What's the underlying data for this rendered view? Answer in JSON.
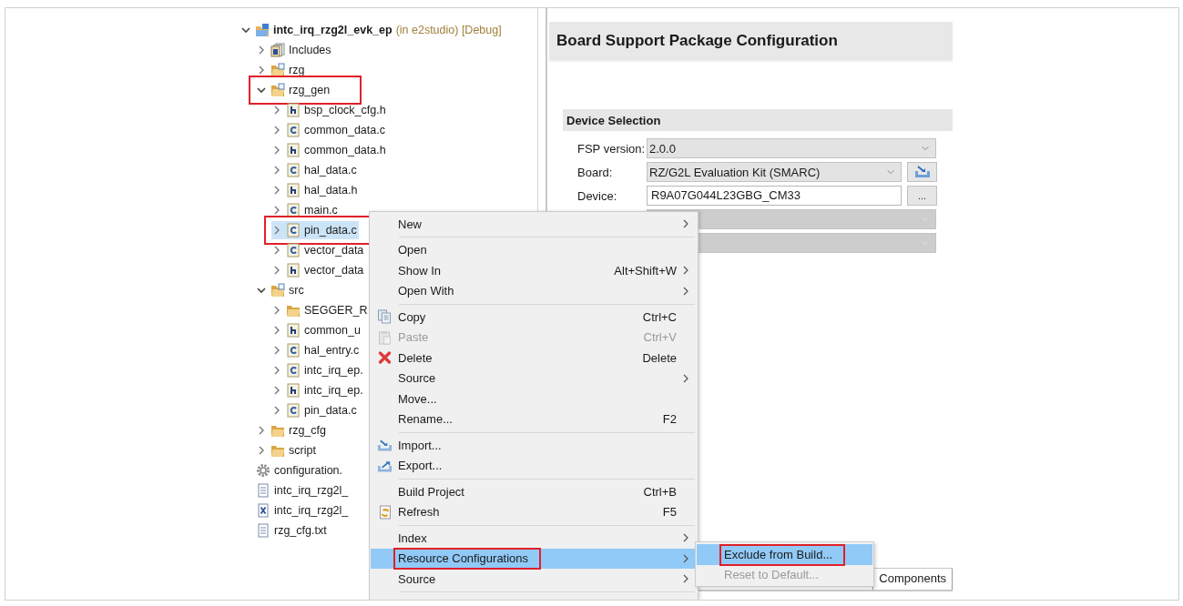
{
  "tree": [
    {
      "label": "intc_irq_rzg2l_evk_ep",
      "note": "(in e2studio) [Debug]",
      "kind": "project",
      "expanded": true,
      "selected": false,
      "callout": false,
      "children": [
        {
          "label": "Includes",
          "kind": "includes",
          "expanded": false,
          "selected": false,
          "callout": false
        },
        {
          "label": "rzg",
          "kind": "src-folder",
          "expanded": false,
          "selected": false,
          "callout": false
        },
        {
          "label": "rzg_gen",
          "kind": "src-folder",
          "expanded": true,
          "selected": false,
          "callout": true,
          "children": [
            {
              "label": "bsp_clock_cfg.h",
              "kind": "h-file",
              "expanded": false,
              "selected": false,
              "callout": false
            },
            {
              "label": "common_data.c",
              "kind": "c-file",
              "expanded": false,
              "selected": false,
              "callout": false
            },
            {
              "label": "common_data.h",
              "kind": "h-file",
              "expanded": false,
              "selected": false,
              "callout": false
            },
            {
              "label": "hal_data.c",
              "kind": "c-file",
              "expanded": false,
              "selected": false,
              "callout": false
            },
            {
              "label": "hal_data.h",
              "kind": "h-file",
              "expanded": false,
              "selected": false,
              "callout": false
            },
            {
              "label": "main.c",
              "kind": "c-file",
              "expanded": false,
              "selected": false,
              "callout": false
            },
            {
              "label": "pin_data.c",
              "kind": "c-file",
              "expanded": false,
              "selected": true,
              "callout": true
            },
            {
              "label": "vector_data",
              "kind": "c-file",
              "expanded": false,
              "selected": false,
              "callout": false
            },
            {
              "label": "vector_data",
              "kind": "h-file",
              "expanded": false,
              "selected": false,
              "callout": false
            }
          ]
        },
        {
          "label": "src",
          "kind": "src-folder",
          "expanded": true,
          "selected": false,
          "callout": false,
          "children": [
            {
              "label": "SEGGER_R",
              "kind": "folder",
              "expanded": false,
              "selected": false,
              "callout": false
            },
            {
              "label": "common_u",
              "kind": "h-file",
              "expanded": false,
              "selected": false,
              "callout": false
            },
            {
              "label": "hal_entry.c",
              "kind": "c-file",
              "expanded": false,
              "selected": false,
              "callout": false
            },
            {
              "label": "intc_irq_ep.",
              "kind": "c-file",
              "expanded": false,
              "selected": false,
              "callout": false
            },
            {
              "label": "intc_irq_ep.",
              "kind": "h-file",
              "expanded": false,
              "selected": false,
              "callout": false
            },
            {
              "label": "pin_data.c",
              "kind": "c-file",
              "expanded": false,
              "selected": false,
              "callout": false
            }
          ]
        },
        {
          "label": "rzg_cfg",
          "kind": "folder",
          "expanded": false,
          "selected": false,
          "callout": false
        },
        {
          "label": "script",
          "kind": "folder",
          "expanded": false,
          "selected": false,
          "callout": false
        },
        {
          "label": "configuration.",
          "kind": "gear",
          "selected": false,
          "callout": false
        },
        {
          "label": "intc_irq_rzg2l_",
          "kind": "text-file",
          "selected": false,
          "callout": false
        },
        {
          "label": "intc_irq_rzg2l_",
          "kind": "xml-file",
          "selected": false,
          "callout": false
        },
        {
          "label": "rzg_cfg.txt",
          "kind": "text-file",
          "selected": false,
          "callout": false
        }
      ]
    }
  ],
  "editor": {
    "title": "Board Support Package Configuration",
    "section": "Device Selection",
    "fields": [
      {
        "label": "FSP version:",
        "value": "2.0.0",
        "kind": "dropdown",
        "disabled": false
      },
      {
        "label": "Board:",
        "value": "RZ/G2L Evaluation Kit (SMARC)",
        "kind": "dropdown",
        "disabled": false,
        "button": {
          "kind": "icon"
        }
      },
      {
        "label": "Device:",
        "value": "R9A07G044L23GBG_CM33",
        "kind": "text",
        "disabled": false,
        "button": {
          "kind": "text",
          "label": "..."
        }
      },
      {
        "kind": "dropdown",
        "disabled": true
      },
      {
        "kind": "dropdown",
        "disabled": true
      }
    ],
    "tabs": [
      {
        "label": "Components",
        "selected": false
      }
    ]
  },
  "context_menu": {
    "groups": [
      [
        {
          "label": "New",
          "kind": "plain",
          "submenu": true,
          "selected": false,
          "disabled": false,
          "callout": false
        }
      ],
      [
        {
          "label": "Open",
          "kind": "plain",
          "submenu": false,
          "selected": false,
          "disabled": false,
          "callout": false
        },
        {
          "label": "Show In",
          "shortcut": "Alt+Shift+W",
          "kind": "plain",
          "submenu": true,
          "selected": false,
          "disabled": false,
          "callout": false
        },
        {
          "label": "Open With",
          "kind": "plain",
          "submenu": true,
          "selected": false,
          "disabled": false,
          "callout": false
        }
      ],
      [
        {
          "label": "Copy",
          "shortcut": "Ctrl+C",
          "kind": "copy",
          "submenu": false,
          "selected": false,
          "disabled": false,
          "callout": false
        },
        {
          "label": "Paste",
          "shortcut": "Ctrl+V",
          "kind": "paste",
          "submenu": false,
          "selected": false,
          "disabled": true,
          "callout": false
        },
        {
          "label": "Delete",
          "shortcut": "Delete",
          "kind": "delete",
          "submenu": false,
          "selected": false,
          "disabled": false,
          "callout": false
        },
        {
          "label": "Source",
          "kind": "plain",
          "submenu": true,
          "selected": false,
          "disabled": false,
          "callout": false
        },
        {
          "label": "Move...",
          "kind": "plain",
          "submenu": false,
          "selected": false,
          "disabled": false,
          "callout": false
        },
        {
          "label": "Rename...",
          "shortcut": "F2",
          "kind": "plain",
          "submenu": false,
          "selected": false,
          "disabled": false,
          "callout": false
        }
      ],
      [
        {
          "label": "Import...",
          "kind": "import",
          "submenu": false,
          "selected": false,
          "disabled": false,
          "callout": false
        },
        {
          "label": "Export...",
          "kind": "export",
          "submenu": false,
          "selected": false,
          "disabled": false,
          "callout": false
        }
      ],
      [
        {
          "label": "Build Project",
          "shortcut": "Ctrl+B",
          "kind": "plain",
          "submenu": false,
          "selected": false,
          "disabled": false,
          "callout": false
        },
        {
          "label": "Refresh",
          "shortcut": "F5",
          "kind": "refresh",
          "submenu": false,
          "selected": false,
          "disabled": false,
          "callout": false
        }
      ],
      [
        {
          "label": "Index",
          "kind": "plain",
          "submenu": true,
          "selected": false,
          "disabled": false,
          "callout": false
        },
        {
          "label": "Resource Configurations",
          "kind": "plain",
          "submenu": true,
          "selected": true,
          "disabled": false,
          "callout": true
        },
        {
          "label": "Source",
          "kind": "plain",
          "submenu": true,
          "selected": false,
          "disabled": false,
          "callout": false
        }
      ]
    ]
  },
  "submenu": [
    {
      "label": "Exclude from Build...",
      "selected": true,
      "disabled": false,
      "callout": true
    },
    {
      "label": "Reset to Default...",
      "selected": false,
      "disabled": true,
      "callout": false
    }
  ]
}
